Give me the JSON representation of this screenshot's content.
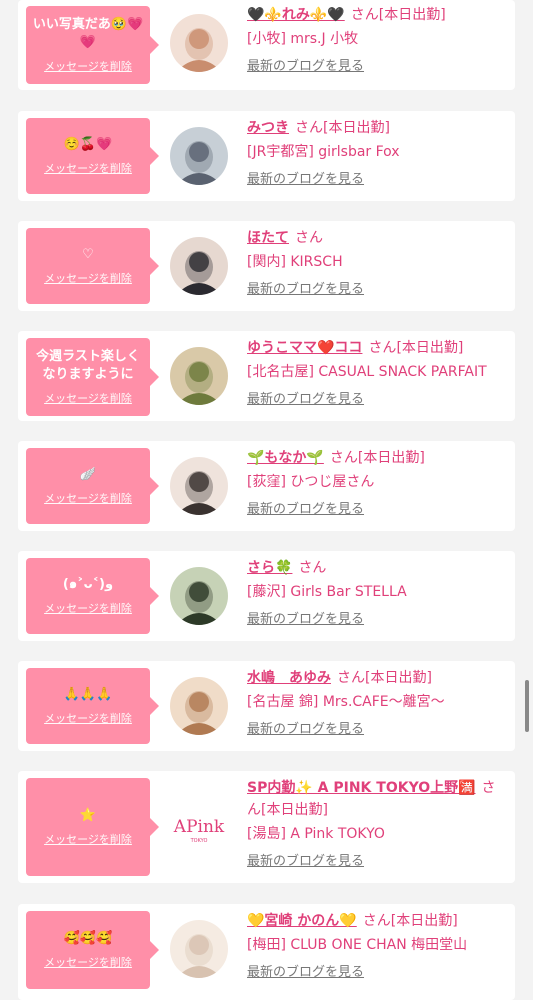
{
  "delete_label": "メッセージを削除",
  "blog_label": "最新のブログを見る",
  "san_label": "さん",
  "attendance_label": "[本日出勤]",
  "entries": [
    {
      "message": "いい写真だあ🥹💗💗",
      "name": "🖤⚜️れみ⚜️🖤",
      "attendance": true,
      "shop": "[小牧] mrs.J 小牧"
    },
    {
      "message": "☺️🍒💗",
      "name": "みつき",
      "attendance": true,
      "shop": "[JR宇都宮] girlsbar Fox"
    },
    {
      "message": "♡",
      "name": "ほたて",
      "attendance": false,
      "shop": "[関内] KIRSCH"
    },
    {
      "message": "今週ラスト楽しくなりますように",
      "name": "ゆうこママ❤️ココ",
      "attendance": true,
      "shop": "[北名古屋] CASUAL SNACK PARFAIT"
    },
    {
      "message": "🪽",
      "name": "🌱もなか🌱",
      "attendance": true,
      "shop": "[荻窪] ひつじ屋さん"
    },
    {
      "message": "(๑˃ᴗ˂)ﻭ",
      "name": "さら🍀",
      "attendance": false,
      "shop": "[藤沢] Girls Bar STELLA"
    },
    {
      "message": "🙏🙏🙏",
      "name": "水嶋　あゆみ",
      "attendance": true,
      "shop": "[名古屋 錦] Mrs.CAFE〜離宮〜"
    },
    {
      "message": "⭐️",
      "name": "SP内勤✨ A PINK TOKYO上野🈵",
      "attendance": true,
      "shop": "[湯島] A Pink TOKYO"
    },
    {
      "message": "🥰🥰🥰",
      "name": "💛宮崎 かのん💛",
      "attendance": true,
      "shop": "[梅田] CLUB ONE CHAN 梅田堂山"
    }
  ]
}
